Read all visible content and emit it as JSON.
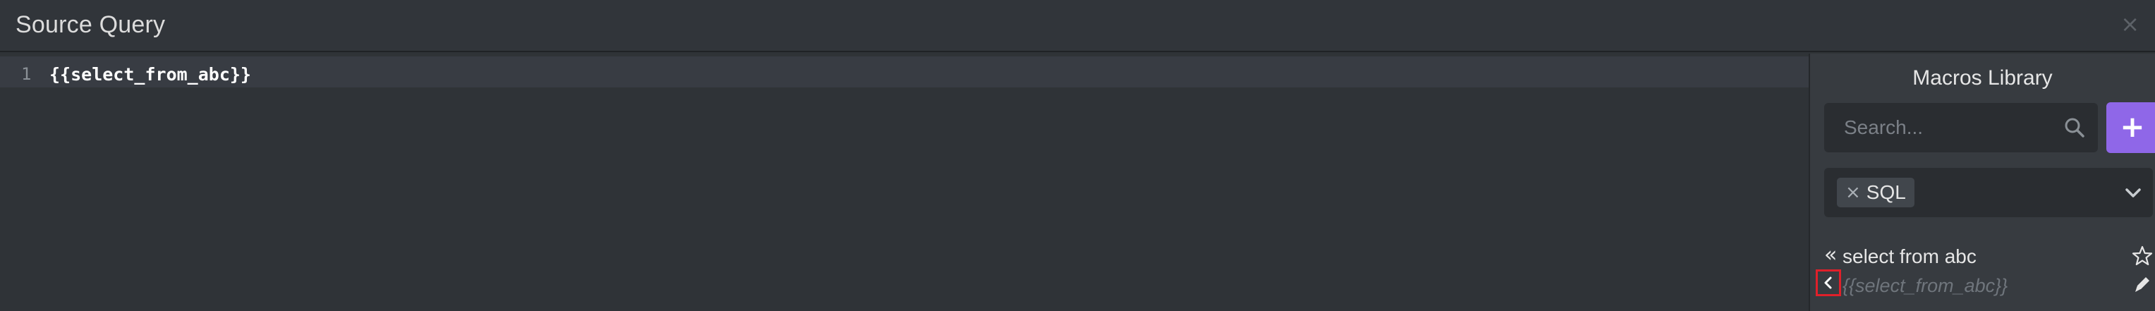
{
  "window": {
    "title": "Source Query",
    "close_glyph": "×"
  },
  "editor": {
    "lines": [
      {
        "number": "1",
        "text": "{{select_from_abc}}"
      }
    ]
  },
  "macros_library": {
    "title": "Macros Library",
    "search": {
      "placeholder": "Search...",
      "value": "",
      "icon": "search-icon"
    },
    "add_button": {
      "label": "+",
      "color": "#8f67e8"
    },
    "filter": {
      "chips": [
        {
          "remove_glyph": "×",
          "label": "SQL"
        }
      ],
      "dropdown_icon": "chevron-down-icon"
    },
    "items": [
      {
        "expand_glyph": "«",
        "name": "select from abc",
        "code": "{{select_from_abc}}",
        "favorite_icon": "star-icon",
        "edit_icon": "pencil-icon",
        "collapse_icon": "chevron-left-icon"
      }
    ]
  },
  "colors": {
    "background": "#2f3337",
    "panel": "#373b40",
    "accent": "#8f67e8",
    "highlight_border": "#e0202a"
  }
}
